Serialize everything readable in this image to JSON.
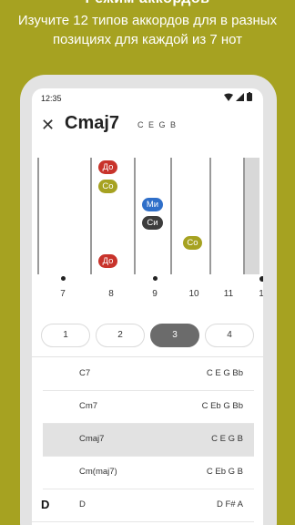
{
  "promo": {
    "top_text": "Режим аккордов",
    "line1": "Изучите 12 типов аккордов для в разных",
    "line2": "позициях для каждой из 7 нот"
  },
  "status_bar": {
    "time": "12:35",
    "icons": [
      "wifi-icon",
      "signal-icon",
      "battery-icon"
    ]
  },
  "header": {
    "close_icon": "close-icon",
    "chord_name": "Cmaj7",
    "chord_notes": "C E G B"
  },
  "fretboard": {
    "notes": [
      {
        "label": "До",
        "color": "#c8332b"
      },
      {
        "label": "Со",
        "color": "#a6a221"
      },
      {
        "label": "Ми",
        "color": "#2f6fc9"
      },
      {
        "label": "Си",
        "color": "#3c3c3c"
      },
      {
        "label": "Со",
        "color": "#a6a221"
      },
      {
        "label": "До",
        "color": "#c8332b"
      }
    ],
    "fret_numbers": [
      "7",
      "8",
      "9",
      "10",
      "11",
      "1"
    ]
  },
  "positions": {
    "options": [
      "1",
      "2",
      "3",
      "4"
    ],
    "selected": "3"
  },
  "chords": [
    {
      "letter": "",
      "name": "C7",
      "notes": "C E G Bb",
      "active": false
    },
    {
      "letter": "",
      "name": "Cm7",
      "notes": "C Eb G Bb",
      "active": false
    },
    {
      "letter": "",
      "name": "Cmaj7",
      "notes": "C E G B",
      "active": true
    },
    {
      "letter": "",
      "name": "Cm(maj7)",
      "notes": "C Eb G B",
      "active": false
    },
    {
      "letter": "D",
      "name": "D",
      "notes": "D F# A",
      "active": false
    }
  ],
  "colors": {
    "background": "#a6a221",
    "note_red": "#c8332b",
    "note_olive": "#a6a221",
    "note_blue": "#2f6fc9",
    "note_dark": "#3c3c3c",
    "selected_position": "#6b6b6b"
  }
}
